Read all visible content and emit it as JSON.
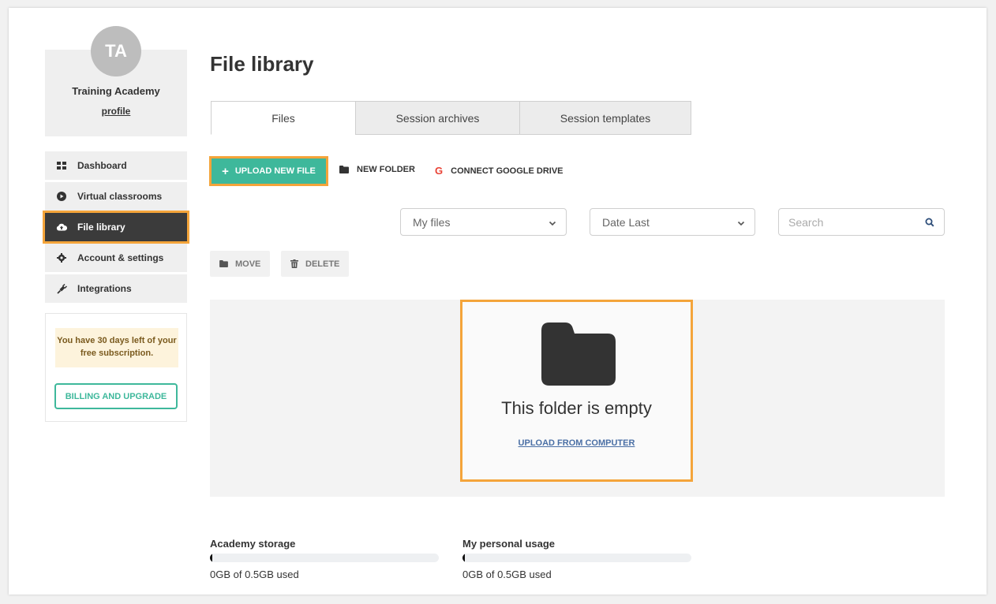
{
  "sidebar": {
    "avatar_initials": "TA",
    "profile_name": "Training Academy",
    "profile_link": "profile",
    "nav": [
      {
        "label": "Dashboard",
        "icon": "dashboard-icon"
      },
      {
        "label": "Virtual classrooms",
        "icon": "play-circle-icon"
      },
      {
        "label": "File library",
        "icon": "cloud-icon",
        "active": true
      },
      {
        "label": "Account & settings",
        "icon": "gear-icon"
      },
      {
        "label": "Integrations",
        "icon": "plug-icon"
      }
    ],
    "subscription_note": "You have 30 days left of your free subscription.",
    "billing_button": "BILLING AND UPGRADE"
  },
  "main": {
    "title": "File library",
    "tabs": [
      {
        "label": "Files",
        "active": true
      },
      {
        "label": "Session archives"
      },
      {
        "label": "Session templates"
      }
    ],
    "toolbar": {
      "upload_label": "UPLOAD NEW FILE",
      "new_folder_label": "NEW FOLDER",
      "google_drive_label": "CONNECT GOOGLE DRIVE"
    },
    "filters": {
      "owner_selected": "My files",
      "sort_selected": "Date Last",
      "search_placeholder": "Search"
    },
    "actions": {
      "move_label": "MOVE",
      "delete_label": "DELETE"
    },
    "empty_state": {
      "message": "This folder is empty",
      "link": "UPLOAD FROM COMPUTER"
    },
    "storage": {
      "academy_title": "Academy storage",
      "academy_usage": "0GB of 0.5GB used",
      "academy_fraction": 0,
      "personal_title": "My personal usage",
      "personal_usage": "0GB of 0.5GB used",
      "personal_fraction": 0
    }
  },
  "colors": {
    "accent": "#3eb89b",
    "highlight": "#f4a43a",
    "active_nav": "#3b3b3b"
  }
}
